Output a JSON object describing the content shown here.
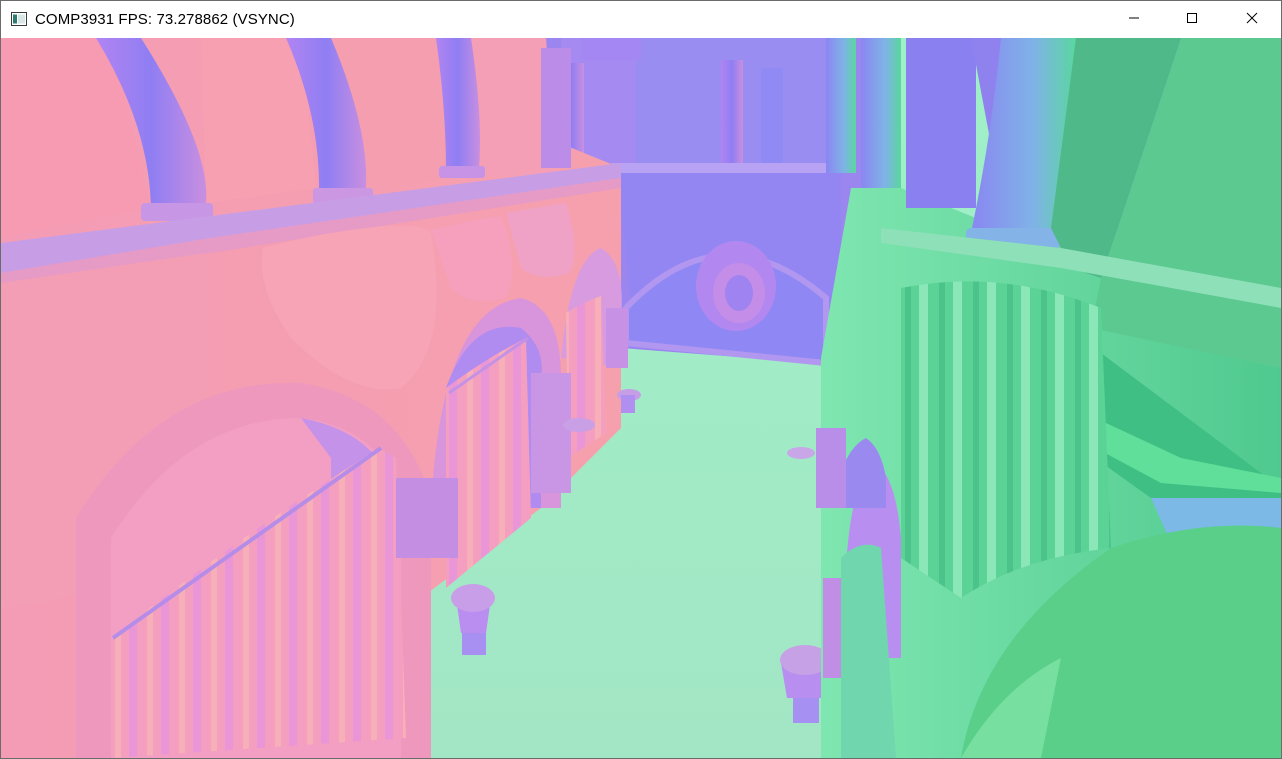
{
  "window": {
    "title": "COMP3931 FPS: 73.278862 (VSYNC)",
    "app_icon": "window-app-icon",
    "controls": {
      "minimize_icon": "minimize-icon",
      "maximize_icon": "maximize-icon",
      "close_icon": "close-icon"
    }
  },
  "viewport": {
    "description_icon": "render-viewport",
    "colors": {
      "floor": "#9fe8c3",
      "left_wall": "#f79cb0",
      "back_wall": "#9b86f0",
      "right_wall": "#5fd89a",
      "column_purple": "#a07ef0",
      "curtain_pink": "#f59abf"
    }
  }
}
